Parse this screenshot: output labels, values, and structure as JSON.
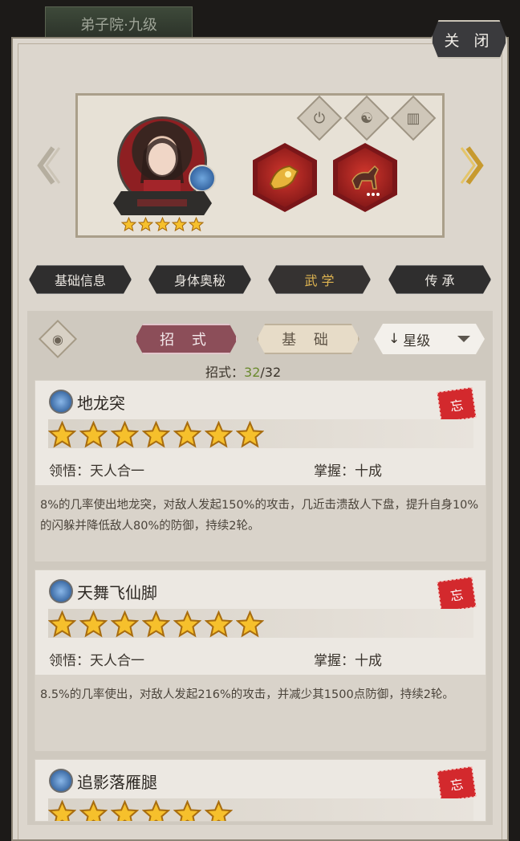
{
  "top_tab": {
    "label": "弟子院·九级"
  },
  "close_button": {
    "label": "关 闭"
  },
  "nav_tabs": [
    {
      "label": "基础信息"
    },
    {
      "label": "身体奥秘"
    },
    {
      "label": "武 学"
    },
    {
      "label": "传 承"
    }
  ],
  "filter": {
    "tab_moves": "招 式",
    "tab_basic": "基 础",
    "sort_label": "星级",
    "sort_arrow": "↓"
  },
  "moves_count": {
    "label": "招式：",
    "current": "32",
    "total": "/32"
  },
  "hero": {
    "stars": 5
  },
  "skills": [
    {
      "name": "地龙突",
      "stars": 7,
      "comprehension_label": "领悟：",
      "comprehension_value": "天人合一",
      "mastery_label": "掌握：",
      "mastery_value": "十成",
      "description": "8%的几率使出地龙突，对敌人发起150%的攻击，几近击溃敌人下盘，提升自身10%的闪躲并降低敌人80%的防御，持续2轮。",
      "forget_label": "忘"
    },
    {
      "name": "天舞飞仙脚",
      "stars": 7,
      "comprehension_label": "领悟：",
      "comprehension_value": "天人合一",
      "mastery_label": "掌握：",
      "mastery_value": "十成",
      "description": "8.5%的几率使出，对敌人发起216%的攻击，并减少其1500点防御，持续2轮。",
      "forget_label": "忘"
    },
    {
      "name": "追影落雁腿",
      "stars": 6,
      "forget_label": "忘"
    }
  ]
}
